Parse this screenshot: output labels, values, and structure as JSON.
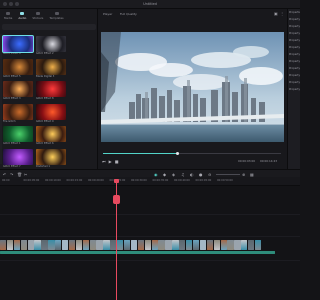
{
  "window": {
    "title": "Untitled"
  },
  "media": {
    "tabs": [
      {
        "label": "Media",
        "icon": "media-icon"
      },
      {
        "label": "Audio",
        "icon": "music-icon"
      },
      {
        "label": "Stickers",
        "icon": "sticker-icon"
      },
      {
        "label": "Templates",
        "icon": "template-icon"
      }
    ],
    "active_tab": 1,
    "thumbnails": [
      {
        "label": "Glitch Effect 4",
        "colors": [
          "#1a2e7a",
          "#3b6cff",
          "#a44dff"
        ]
      },
      {
        "label": "Glitch Effect 2",
        "colors": [
          "#1d1d24",
          "#d9d9e0",
          "#3e3e48"
        ]
      },
      {
        "label": "Glitch Effect 5",
        "colors": [
          "#3a1f10",
          "#d98a3a",
          "#5a2d10"
        ]
      },
      {
        "label": "Blade Digital 3",
        "colors": [
          "#2a1a0f",
          "#f0b04a",
          "#6a3a16"
        ]
      },
      {
        "label": "Glitch Effect 3",
        "colors": [
          "#3a1d12",
          "#ffb05a",
          "#6b2a1a"
        ]
      },
      {
        "label": "Glitch Effect 8",
        "colors": [
          "#7a0d14",
          "#ff3b3b",
          "#1b0b12"
        ]
      },
      {
        "label": "Fire Glitch",
        "colors": [
          "#3b1e10",
          "#c96b2a",
          "#9b3d1d"
        ]
      },
      {
        "label": "Glitch Effect 9",
        "colors": [
          "#8a0f14",
          "#ff5a2a",
          "#2a0a0a"
        ]
      },
      {
        "label": "Glitch Effect 1",
        "colors": [
          "#10602e",
          "#4ad06a",
          "#0d3018"
        ]
      },
      {
        "label": "Glitch Effect 6",
        "colors": [
          "#3a1c10",
          "#ffcc5a",
          "#a85a18"
        ]
      },
      {
        "label": "Glitch Effect 7",
        "colors": [
          "#5a1f8c",
          "#c25cff",
          "#1d0f3a"
        ]
      },
      {
        "label": "Distorted 1",
        "colors": [
          "#2e1a10",
          "#ffd05a",
          "#b3651a"
        ]
      },
      {
        "label": "Glitch Effect 10",
        "colors": [
          "#3b2414",
          "#e8a060",
          "#6e3d1e"
        ]
      },
      {
        "label": "Glitch Effect 11",
        "colors": [
          "#3a1e0e",
          "#f2b24a",
          "#8c4a14"
        ]
      }
    ]
  },
  "preview": {
    "mode_label": "Player",
    "quality_label": "Full Quality",
    "current_time": "00:00:03:00",
    "total_time": "00:00:14:23",
    "progress": 0.42
  },
  "properties": {
    "items": [
      "Properties",
      "Property 1",
      "Property 2",
      "Property 3",
      "Property 4",
      "Property 5",
      "Property 6",
      "Property 7",
      "Property 8",
      "Property 9",
      "Property 10",
      "Property 11"
    ]
  },
  "timeline": {
    "ruler": [
      "00:00",
      "00:00:05:00",
      "00:00:10:00",
      "00:00:15:00",
      "00:00:20:00",
      "00:00:25:00",
      "00:00:30:00",
      "00:00:35:00",
      "00:00:40:00",
      "00:00:45:00",
      "00:00:50:00"
    ],
    "playhead_time": "00:00:20:10",
    "clip_count": 38,
    "clip_colors": [
      "#6b7680",
      "#8e8a7e",
      "#a56a4a",
      "#7f8a92",
      "#9aa4ad",
      "#c2c5c9",
      "#5c6870",
      "#3a8ea8",
      "#6aa3bf",
      "#a3b7c6"
    ]
  },
  "colors": {
    "accent": "#52d3c8",
    "playhead": "#e84a5f",
    "audio": "#2e8c7a"
  }
}
